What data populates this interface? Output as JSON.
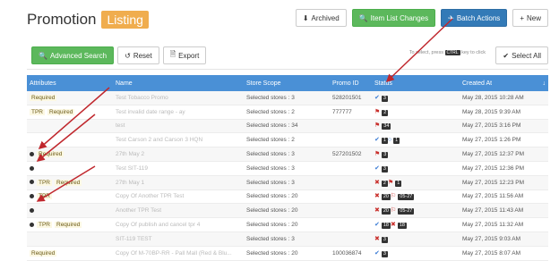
{
  "header": {
    "title": "Promotion",
    "badge": "Listing"
  },
  "top_buttons": [
    {
      "icon": "⬇",
      "label": "Archived",
      "style": "default"
    },
    {
      "icon": "🔍",
      "label": "Item List Changes",
      "style": "green"
    },
    {
      "icon": "✈",
      "label": "Batch Actions",
      "style": "blue"
    },
    {
      "icon": "+",
      "label": "New",
      "style": "default"
    }
  ],
  "toolbar": {
    "advanced_search": "Advanced Search",
    "reset": "Reset",
    "export": "Export",
    "hint_pre": "To select, press",
    "hint_key": "CTRL",
    "hint_post": "key to click",
    "select_all": "Select All"
  },
  "columns": [
    "Attributes",
    "Name",
    "Store Scope",
    "Promo ID",
    "Status",
    "Created At"
  ],
  "rows": [
    {
      "dot": false,
      "attrs": [
        "Required"
      ],
      "name": "Test Tobacco Promo",
      "scope": "Selected stores : 3",
      "promo_id": "528201501",
      "status": [
        {
          "t": "chk"
        },
        {
          "t": "sq",
          "v": "3"
        }
      ],
      "created": "May 28, 2015 10:28 AM"
    },
    {
      "dot": false,
      "attrs": [
        "TPR",
        "Required"
      ],
      "name": "Test invalid date range - ay",
      "scope": "Selected stores : 2",
      "promo_id": "777777",
      "status": [
        {
          "t": "flag"
        },
        {
          "t": "sq",
          "v": "2"
        }
      ],
      "created": "May 28, 2015 9:39 AM"
    },
    {
      "dot": false,
      "attrs": [],
      "name": "test",
      "scope": "Selected stores : 34",
      "promo_id": "",
      "status": [
        {
          "t": "flag"
        },
        {
          "t": "sq",
          "v": "34"
        }
      ],
      "created": "May 27, 2015 3:16 PM"
    },
    {
      "dot": false,
      "attrs": [],
      "name": "Test Carson 2 and Carson 3 HQN",
      "scope": "Selected stores : 2",
      "promo_id": "",
      "status": [
        {
          "t": "chk"
        },
        {
          "t": "sq",
          "v": "1"
        },
        {
          "t": "circle"
        },
        {
          "t": "sq",
          "v": "1"
        }
      ],
      "created": "May 27, 2015 1:26 PM"
    },
    {
      "dot": true,
      "attrs": [
        "Required"
      ],
      "name": "27th May 2",
      "scope": "Selected stores : 3",
      "promo_id": "527201502",
      "status": [
        {
          "t": "flag"
        },
        {
          "t": "sq",
          "v": "3"
        }
      ],
      "created": "May 27, 2015 12:37 PM"
    },
    {
      "dot": true,
      "attrs": [],
      "name": "Test SIT-119",
      "scope": "Selected stores : 3",
      "promo_id": "",
      "status": [
        {
          "t": "chk"
        },
        {
          "t": "sq",
          "v": "3"
        }
      ],
      "created": "May 27, 2015 12:36 PM"
    },
    {
      "dot": true,
      "attrs": [
        "TPR",
        "Required"
      ],
      "name": "27th May 1",
      "scope": "Selected stores : 3",
      "promo_id": "",
      "status": [
        {
          "t": "x"
        },
        {
          "t": "sq",
          "v": "2"
        },
        {
          "t": "flag"
        },
        {
          "t": "sq",
          "v": "1"
        }
      ],
      "created": "May 27, 2015 12:23 PM"
    },
    {
      "dot": true,
      "attrs": [
        "TPR"
      ],
      "name": "Copy Of Another TPR Test",
      "scope": "Selected stores : 20",
      "promo_id": "",
      "status": [
        {
          "t": "x"
        },
        {
          "t": "sq",
          "v": "20"
        },
        {
          "t": "noflag"
        },
        {
          "t": "sq",
          "v": "05-27"
        }
      ],
      "created": "May 27, 2015 11:56 AM"
    },
    {
      "dot": true,
      "attrs": [],
      "name": "Another TPR Test",
      "scope": "Selected stores : 20",
      "promo_id": "",
      "status": [
        {
          "t": "x"
        },
        {
          "t": "sq",
          "v": "20"
        },
        {
          "t": "noflag"
        },
        {
          "t": "sq",
          "v": "05-27"
        }
      ],
      "created": "May 27, 2015 11:43 AM"
    },
    {
      "dot": true,
      "attrs": [
        "TPR",
        "Required"
      ],
      "name": "Copy Of publish and cancel tpr 4",
      "scope": "Selected stores : 20",
      "promo_id": "",
      "status": [
        {
          "t": "chk"
        },
        {
          "t": "sq",
          "v": "18"
        },
        {
          "t": "x"
        },
        {
          "t": "sq",
          "v": "18"
        }
      ],
      "created": "May 27, 2015 11:32 AM"
    },
    {
      "dot": false,
      "attrs": [],
      "name": "SIT-119 TEST",
      "scope": "Selected stores : 3",
      "promo_id": "",
      "status": [
        {
          "t": "x"
        },
        {
          "t": "sq",
          "v": "3"
        }
      ],
      "created": "May 27, 2015 9:03 AM"
    },
    {
      "dot": false,
      "attrs": [
        "Required"
      ],
      "name": "Copy Of M-70BP-RR - Pall Mall (Red & Blu...",
      "scope": "Selected stores : 20",
      "promo_id": "100036874",
      "status": [
        {
          "t": "chk"
        },
        {
          "t": "sq",
          "v": "3"
        }
      ],
      "created": "May 27, 2015 8:07 AM"
    }
  ]
}
